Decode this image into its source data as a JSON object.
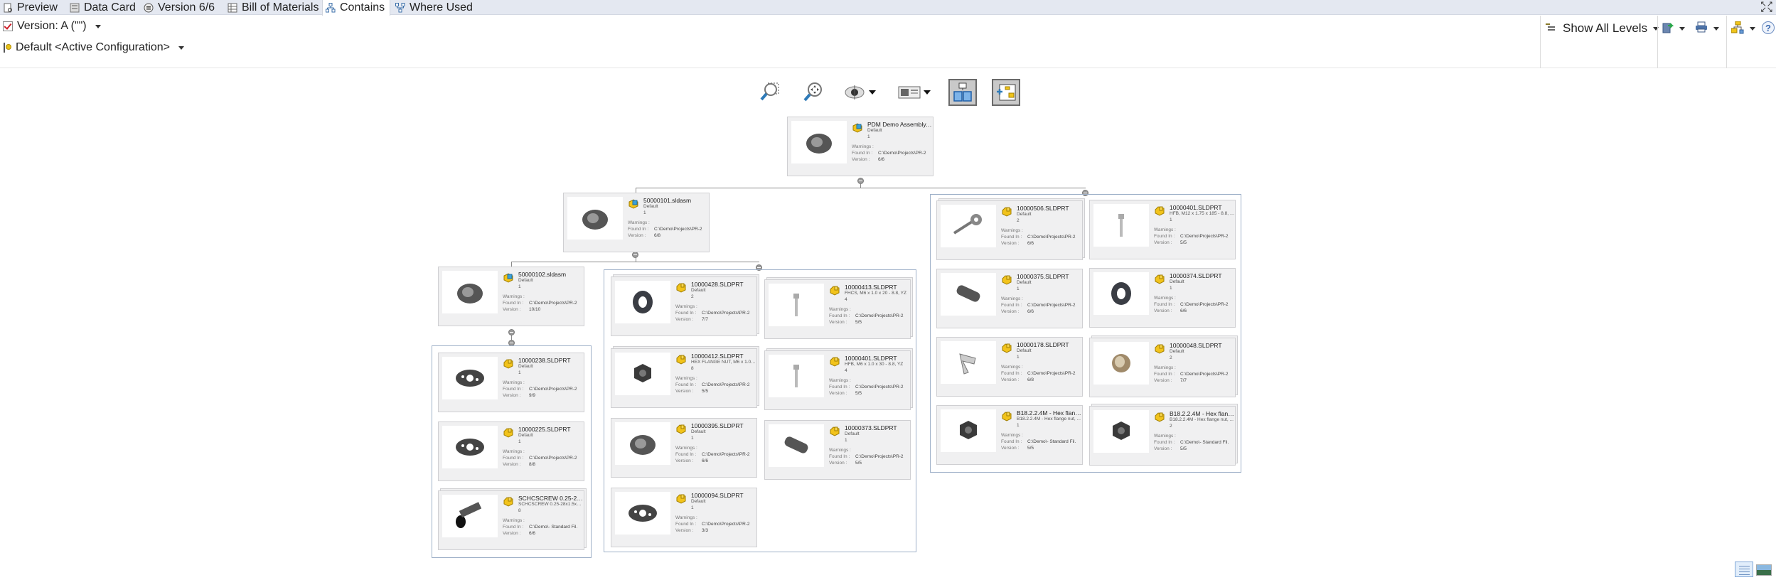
{
  "tabs": [
    {
      "label": "Preview",
      "icon": "preview-icon",
      "active": false
    },
    {
      "label": "Data Card",
      "icon": "data-card-icon",
      "active": false
    },
    {
      "label": "Version 6/6",
      "icon": "version-icon",
      "active": false
    },
    {
      "label": "Bill of Materials",
      "icon": "bom-icon",
      "active": false
    },
    {
      "label": "Contains",
      "icon": "contains-icon",
      "active": true
    },
    {
      "label": "Where Used",
      "icon": "where-used-icon",
      "active": false
    }
  ],
  "header": {
    "version_label": "Version: A (\"\")",
    "configuration_label": "Default <Active Configuration>",
    "show_levels_label": "Show All Levels"
  },
  "colors": {
    "tabbar_bg": "#e4e8f1",
    "card_bg": "#f0f0f1",
    "group_border": "#9eb0c8",
    "part_icon": "#f2c31b",
    "assembly_icon": "#3aa0d8"
  },
  "labels": {
    "warnings": "Warnings :",
    "found_in": "Found In :",
    "version": "Version :"
  },
  "tree": {
    "root": {
      "name": "PDM Demo Assembly.SL...",
      "config": "Default",
      "qty": "1",
      "warnings": "",
      "found_in": "C:\\Demo\\Projects\\PR-2",
      "version": "6/6",
      "type": "assembly"
    },
    "level1_assembly": {
      "name": "50000101.sldasm",
      "config": "Default",
      "qty": "1",
      "warnings": "",
      "found_in": "C:\\Demo\\Projects\\PR-2",
      "version": "6/8",
      "type": "assembly"
    },
    "level2_assembly": {
      "name": "50000102.sldasm",
      "config": "Default",
      "qty": "1",
      "warnings": "",
      "found_in": "C:\\Demo\\Projects\\PR-2",
      "version": "10/10",
      "type": "assembly"
    },
    "level3_parts": [
      {
        "name": "10000238.SLDPRT",
        "config": "Default",
        "qty": "1",
        "found_in": "C:\\Demo\\Projects\\PR-2",
        "version": "9/9"
      },
      {
        "name": "10000225.SLDPRT",
        "config": "Default",
        "qty": "1",
        "found_in": "C:\\Demo\\Projects\\PR-2",
        "version": "8/8"
      },
      {
        "name": "SCHCSCREW 0.25-28x1.5...",
        "config": "SCHCSCREW 0.25-28x1.5x1.5-...",
        "qty": "8",
        "found_in": "C:\\Demo\\- Standard Fil.",
        "version": "6/6"
      }
    ],
    "level2_parts": [
      {
        "name": "10000428.SLDPRT",
        "config": "Default",
        "qty": "2",
        "found_in": "C:\\Demo\\Projects\\PR-2",
        "version": "7/7"
      },
      {
        "name": "10000413.SLDPRT",
        "config": "FHCS, M6 x 1.0 x 20 - 8.8, YZ",
        "qty": "4",
        "found_in": "C:\\Demo\\Projects\\PR-2",
        "version": "5/5"
      },
      {
        "name": "10000412.SLDPRT",
        "config": "HEX FLANGE NUT, M6 x 1.0 - ...",
        "qty": "8",
        "found_in": "C:\\Demo\\Projects\\PR-2",
        "version": "5/5"
      },
      {
        "name": "10000401.SLDPRT",
        "config": "HFB, M6 x 1.0 x 30 - 8.8, YZ",
        "qty": "4",
        "found_in": "C:\\Demo\\Projects\\PR-2",
        "version": "5/5"
      },
      {
        "name": "10000395.SLDPRT",
        "config": "Default",
        "qty": "1",
        "found_in": "C:\\Demo\\Projects\\PR-2",
        "version": "6/6"
      },
      {
        "name": "10000373.SLDPRT",
        "config": "Default",
        "qty": "1",
        "found_in": "C:\\Demo\\Projects\\PR-2",
        "version": "5/5"
      },
      {
        "name": "10000094.SLDPRT",
        "config": "Default",
        "qty": "1",
        "found_in": "C:\\Demo\\Projects\\PR-2",
        "version": "3/3"
      }
    ],
    "level1_parts": [
      {
        "name": "10000506.SLDPRT",
        "config": "Default",
        "qty": "2",
        "found_in": "C:\\Demo\\Projects\\PR-2",
        "version": "6/6"
      },
      {
        "name": "10000401.SLDPRT",
        "config": "HFB, M12 x 1.75 x 185 - 8.8, YZ",
        "qty": "1",
        "found_in": "C:\\Demo\\Projects\\PR-2",
        "version": "5/5"
      },
      {
        "name": "10000375.SLDPRT",
        "config": "Default",
        "qty": "1",
        "found_in": "C:\\Demo\\Projects\\PR-2",
        "version": "6/6"
      },
      {
        "name": "10000374.SLDPRT",
        "config": "Default",
        "qty": "1",
        "found_in": "C:\\Demo\\Projects\\PR-2",
        "version": "6/6"
      },
      {
        "name": "10000178.SLDPRT",
        "config": "Default",
        "qty": "1",
        "found_in": "C:\\Demo\\Projects\\PR-2",
        "version": "6/8"
      },
      {
        "name": "10000048.SLDPRT",
        "config": "Default",
        "qty": "2",
        "found_in": "C:\\Demo\\Projects\\PR-2",
        "version": "7/7"
      },
      {
        "name": "B18.2.2.4M - Hex flange n...",
        "config": "B18.2.2.4M - Hex flange nut, ...",
        "qty": "1",
        "found_in": "C:\\Demo\\- Standard Fil.",
        "version": "5/5"
      },
      {
        "name": "B18.2.2.4M - Hex flange n...",
        "config": "B18.2.2.4M - Hex flange nut, ...",
        "qty": "2",
        "found_in": "C:\\Demo\\- Standard Fil.",
        "version": "5/5"
      }
    ]
  }
}
